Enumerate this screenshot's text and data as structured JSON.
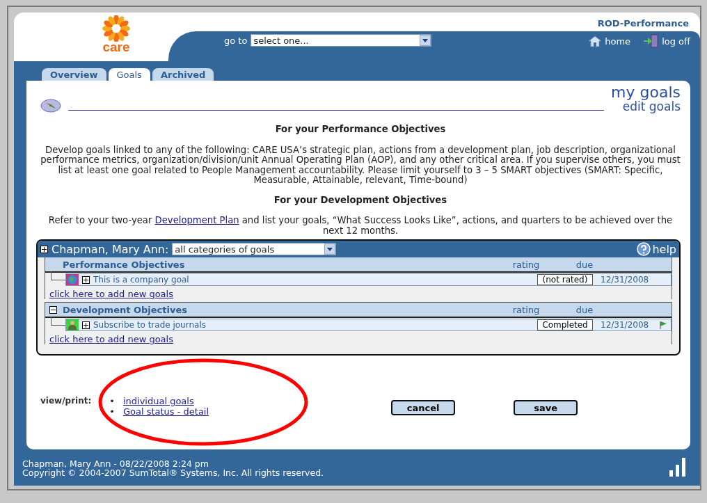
{
  "header": {
    "logo_text": "care",
    "app_title": "ROD-Performance",
    "goto_label": "go to",
    "goto_value": "select one...",
    "links": [
      {
        "kind": "home",
        "label": "home"
      },
      {
        "kind": "logoff",
        "label": "log off"
      }
    ]
  },
  "tabs": [
    {
      "label": "Overview",
      "selected": false
    },
    {
      "label": "Goals",
      "selected": true
    },
    {
      "label": "Archived",
      "selected": false
    }
  ],
  "page": {
    "title": "my goals",
    "subtitle": "edit goals"
  },
  "intro": [
    {
      "heading": "For your Performance Objectives",
      "text": "Develop goals linked to any of the following: CARE USA’s strategic plan, actions from a development plan, job description, organizational performance metrics, organization/division/unit Annual Operating Plan (AOP), and any other critical area. If you supervise others, you must list at least one goal related to People Management accountability. Please limit yourself to 3 – 5 SMART objectives (SMART: Specific, Measurable, Attainable, relevant, Time-bound)"
    },
    {
      "heading": "For your Development Objectives",
      "text_before": "Refer to your two-year ",
      "link": "Development Plan",
      "text_after": " and list your goals, “What Success Looks Like”, actions, and quarters to be achieved over the next 12 months."
    }
  ],
  "goals_panel": {
    "person": "Chapman, Mary Ann:",
    "category_filter": "all categories of goals",
    "help": "help",
    "groups": [
      {
        "name": "Performance Objectives",
        "collapsible": false,
        "rating_header": "rating",
        "due_header": "due",
        "add_link": "click here to add new goals",
        "goals": [
          {
            "kind": "company",
            "title": "This is a company goal",
            "rating": "(not rated)",
            "due": "12/31/2008",
            "flagged": false
          }
        ]
      },
      {
        "name": "Development Objectives",
        "collapsible": true,
        "rating_header": "rating",
        "due_header": "due",
        "add_link": "click here to add new goals",
        "goals": [
          {
            "kind": "personal",
            "title": "Subscribe to trade journals",
            "rating": "Completed",
            "due": "12/31/2008",
            "flagged": true
          }
        ]
      }
    ]
  },
  "view_print": {
    "label": "view/print:",
    "links": [
      {
        "bullet": "•",
        "label": "individual goals"
      },
      {
        "bullet": "•",
        "label": "Goal status - detail"
      }
    ]
  },
  "buttons": [
    "cancel",
    "save"
  ],
  "footer": {
    "user_line": "Chapman, Mary Ann - 08/22/2008 2:24 pm",
    "copyright": "Copyright © 2004-2007 SumTotal® Systems, Inc. All rights reserved."
  }
}
